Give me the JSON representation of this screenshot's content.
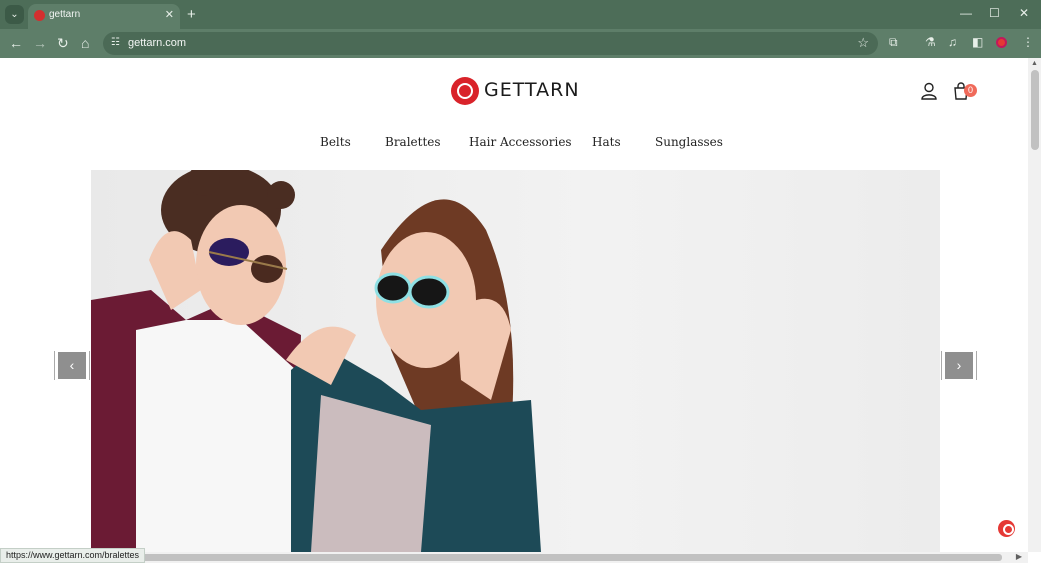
{
  "browser": {
    "tab_title": "gettarn",
    "url": "gettarn.com",
    "status_url": "https://www.gettarn.com/bralettes",
    "accent_color": "#4d6d58"
  },
  "site": {
    "brand": "GETTARN",
    "cart_count": "0",
    "menu": [
      "Belts",
      "Bralettes",
      "Hair Accessories",
      "Hats",
      "Sunglasses"
    ],
    "slider_prev": "‹",
    "slider_next": "›"
  },
  "icons": {
    "tab_search": "⌄",
    "close": "✕",
    "new_tab": "+",
    "minimize": "—",
    "maximize": "☐",
    "back": "←",
    "forward": "→",
    "reload": "↻",
    "home": "⌂",
    "site_info": "☷",
    "bookmark": "☆",
    "extensions": "⧉",
    "labs": "⚗",
    "media": "♫",
    "sidebar": "◧",
    "menu": "⋮",
    "scroll_up": "▲",
    "scroll_right": "▶"
  }
}
